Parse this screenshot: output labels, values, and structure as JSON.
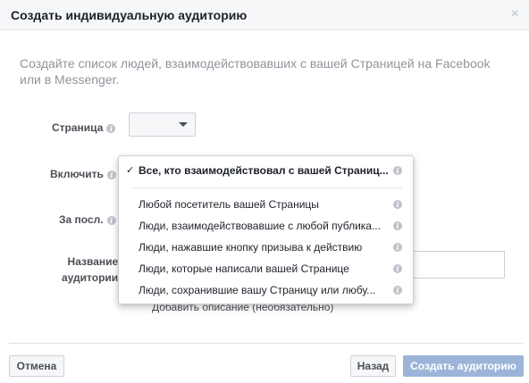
{
  "dialog": {
    "title": "Создать индивидуальную аудиторию",
    "close_symbol": "×"
  },
  "intro_text": "Создайте список людей, взаимодействовавших с вашей Страницей на Facebook или в Messenger.",
  "form": {
    "page_label": "Страница",
    "include_label": "Включить",
    "period_label": "За посл.",
    "name_label_line1": "Название",
    "name_label_line2": "аудитории",
    "add_description": "Добавить описание (необязательно)"
  },
  "info_glyph": "i",
  "include_dropdown": {
    "check_symbol": "✓",
    "selected": "Все, кто взаимодействовал с вашей Страниц...",
    "options": [
      "Любой посетитель вашей Страницы",
      "Люди, взаимодействовавшие с любой публика...",
      "Люди, нажавшие кнопку призыва к действию",
      "Люди, которые написали вашей Странице",
      "Люди, сохранившие вашу Страницу или любу..."
    ]
  },
  "buttons": {
    "cancel": "Отмена",
    "back": "Назад",
    "create": "Создать аудиторию"
  },
  "colors": {
    "header_bg": "#f6f7f9",
    "primary_disabled": "#9cb4d8",
    "muted_text": "#90949c"
  }
}
